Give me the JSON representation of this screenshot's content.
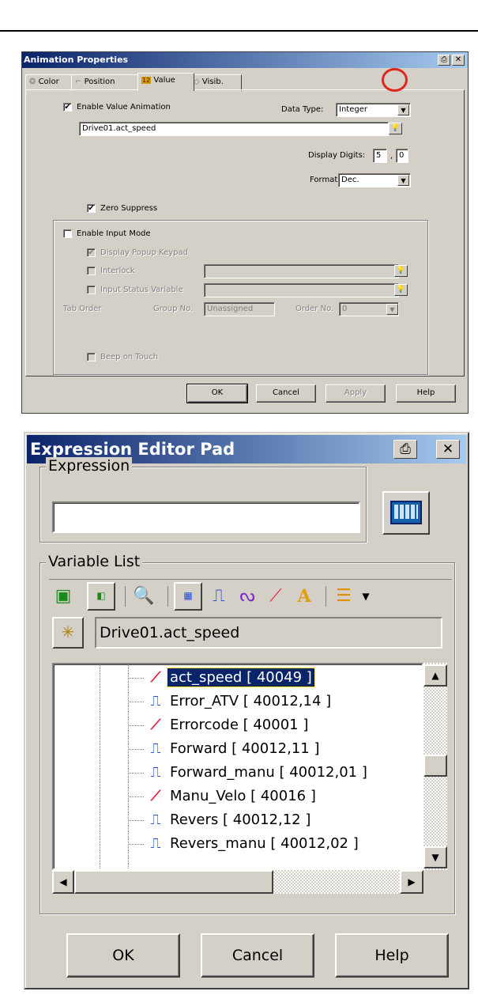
{
  "dialog1": {
    "title": "Animation Properties",
    "tabs": [
      {
        "icon": "❂",
        "label": "Color"
      },
      {
        "icon": "⌐",
        "label": "Position"
      },
      {
        "icon": "12",
        "label": "Value"
      },
      {
        "icon": "◇",
        "label": "Visib."
      }
    ],
    "enable_value_animation": {
      "label": "Enable Value Animation",
      "checked": true
    },
    "data_type": {
      "label": "Data Type:",
      "value": "Integer"
    },
    "variable_value": "Drive01.act_speed",
    "display_digits": {
      "label": "Display Digits:",
      "value1": "5",
      "separator": ",",
      "value2": "0"
    },
    "format": {
      "label": "Format:",
      "value": "Dec."
    },
    "zero_suppress": {
      "label": "Zero Suppress",
      "checked": true
    },
    "enable_input_mode": {
      "label": "Enable Input Mode",
      "checked": false
    },
    "display_popup_keypad": {
      "label": "Display Popup Keypad",
      "checked": true
    },
    "interlock": {
      "label": "Interlock",
      "checked": false
    },
    "input_status_variable": {
      "label": "Input Status Variable",
      "checked": false
    },
    "tab_order_label": "Tab Order",
    "group_no": {
      "label": "Group No.",
      "value": "Unassigned"
    },
    "order_no": {
      "label": "Order No.",
      "value": "0"
    },
    "beep_on_touch": {
      "label": "Beep on Touch",
      "checked": false
    },
    "buttons": {
      "ok": "OK",
      "cancel": "Cancel",
      "apply": "Apply",
      "help": "Help"
    }
  },
  "dialog2": {
    "title": "Expression Editor Pad",
    "expression_label": "Expression",
    "expression_value": "",
    "variable_list_label": "Variable List",
    "selected_variable": "Drive01.act_speed",
    "tree_items": [
      {
        "name": "act_speed [ 40049 ]",
        "icon": "analog",
        "selected": true
      },
      {
        "name": "Error_ATV [ 40012,14 ]",
        "icon": "digital",
        "selected": false
      },
      {
        "name": "Errorcode [ 40001 ]",
        "icon": "analog",
        "selected": false
      },
      {
        "name": "Forward [ 40012,11 ]",
        "icon": "digital",
        "selected": false
      },
      {
        "name": "Forward_manu [ 40012,01 ]",
        "icon": "digital",
        "selected": false
      },
      {
        "name": "Manu_Velo [ 40016 ]",
        "icon": "analog",
        "selected": false
      },
      {
        "name": "Revers [ 40012,12 ]",
        "icon": "digital",
        "selected": false
      },
      {
        "name": "Revers_manu [ 40012,02 ]",
        "icon": "digital",
        "selected": false
      }
    ],
    "buttons": {
      "ok": "OK",
      "cancel": "Cancel",
      "help": "Help"
    }
  },
  "colors": {
    "title_start": "#0a246a",
    "title_end": "#a6caf0",
    "face": "#d4d0c8",
    "highlight_circle": "#e0261c",
    "selection": "#0a246a",
    "digital_icon": "#1f4fd1",
    "analog_icon": "#e0203c"
  }
}
